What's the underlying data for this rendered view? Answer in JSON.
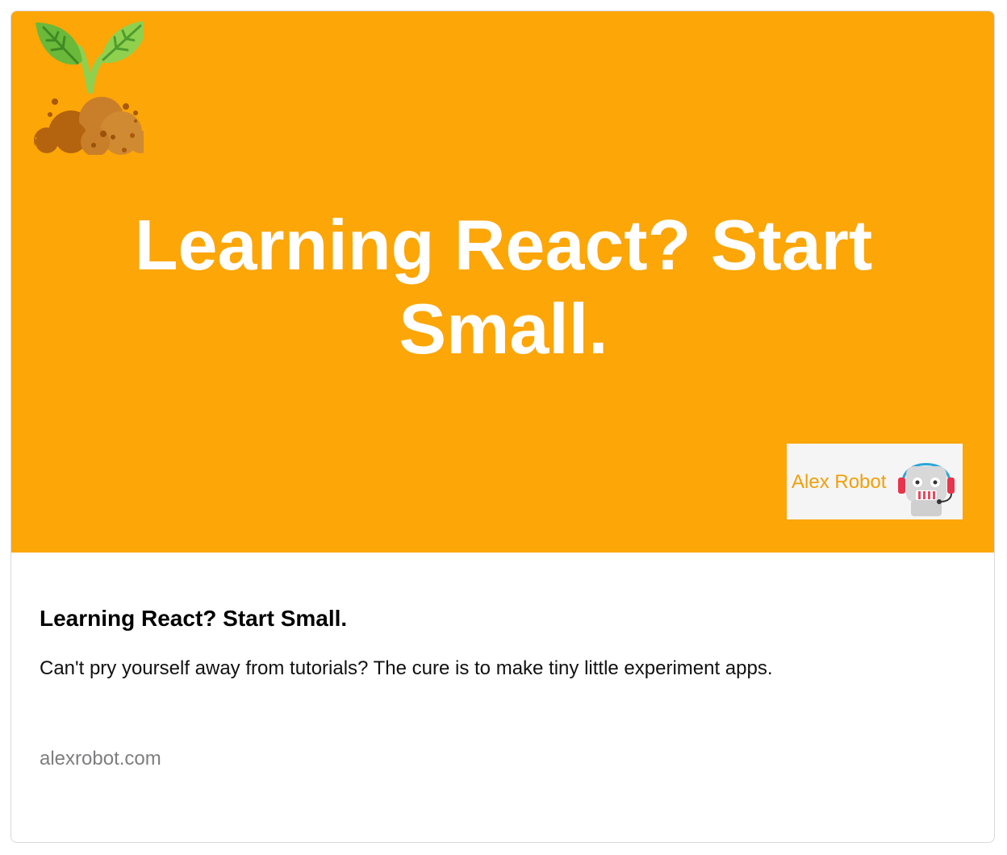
{
  "card": {
    "hero": {
      "background_color": "#fca608",
      "headline": "Learning React? Start Small.",
      "illustration_icon": "sprout-in-soil-icon",
      "badge": {
        "text": "Alex Robot",
        "icon": "robot-with-headset-icon"
      }
    },
    "title": "Learning React? Start Small.",
    "description": "Can't pry yourself away from tutorials? The cure is to make tiny little experiment apps.",
    "domain": "alexrobot.com"
  }
}
